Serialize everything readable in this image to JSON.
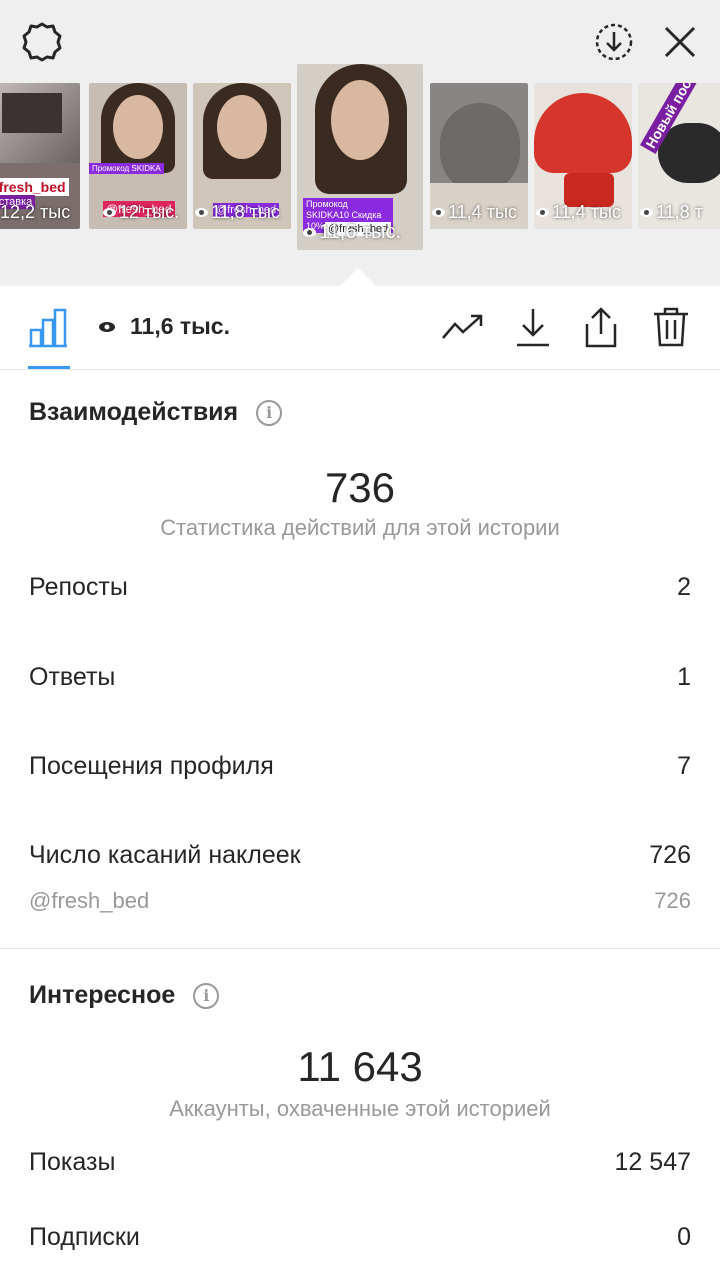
{
  "thumbnails": [
    {
      "views": "12,2 тыс",
      "tag": "@fresh_bed",
      "subtag": "Доставка"
    },
    {
      "views": "12 тыс.",
      "tag": "@fresh_bed"
    },
    {
      "views": "11,8 тыс",
      "tag": "@fresh_bed"
    },
    {
      "views": "11,6 тыс.",
      "tag": "@fresh_bed",
      "promo": "Промокод SKIDKA10 Скидка 10%",
      "selected": true
    },
    {
      "views": "11,4 тыс"
    },
    {
      "views": "11,4 тыс"
    },
    {
      "views": "11,8 т",
      "banner": "Новый пост"
    }
  ],
  "toolbar": {
    "views": "11,6 тыс.",
    "icons": [
      "bar-chart-icon",
      "eye-icon",
      "trending-icon",
      "download-icon",
      "share-icon",
      "trash-icon"
    ]
  },
  "interactions": {
    "title": "Взаимодействия",
    "total": "736",
    "subtitle": "Статистика действий для этой истории",
    "rows": [
      {
        "label": "Репосты",
        "value": "2"
      },
      {
        "label": "Ответы",
        "value": "1"
      },
      {
        "label": "Посещения профиля",
        "value": "7"
      },
      {
        "label": "Число касаний наклеек",
        "value": "726"
      }
    ],
    "sticker": {
      "label": "@fresh_bed",
      "value": "726"
    }
  },
  "discovery": {
    "title": "Интересное",
    "total": "11 643",
    "subtitle": "Аккаунты, охваченные этой историей",
    "rows": [
      {
        "label": "Показы",
        "value": "12 547"
      },
      {
        "label": "Подписки",
        "value": "0"
      }
    ]
  },
  "colors": {
    "accent": "#3897f0",
    "tag": "#8a2be2"
  }
}
